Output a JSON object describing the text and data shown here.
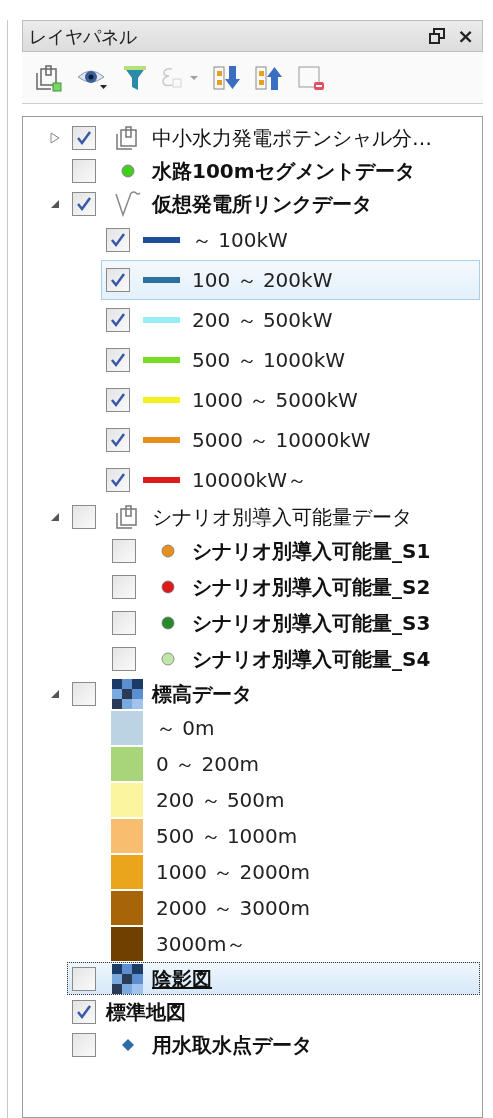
{
  "panel": {
    "title": "レイヤパネル",
    "close": "×"
  },
  "toolbar": [
    {
      "kind": "add-group",
      "disabled": false
    },
    {
      "kind": "visibility",
      "disabled": false
    },
    {
      "kind": "filter",
      "disabled": false
    },
    {
      "kind": "expression",
      "disabled": true
    },
    {
      "kind": "move-down",
      "disabled": false
    },
    {
      "kind": "move-up",
      "disabled": false
    },
    {
      "kind": "remove",
      "disabled": false
    }
  ],
  "tree": [
    {
      "kind": "group",
      "expanded": false,
      "checked": true,
      "bold": false,
      "selected": false,
      "label": "中小水力発電ポテンシャル分…"
    },
    {
      "kind": "point",
      "checked": false,
      "color": "#44cc22",
      "bold": true,
      "selected": false,
      "label": "水路100mセグメントデータ"
    },
    {
      "kind": "line",
      "expanded": true,
      "checked": true,
      "bold": true,
      "selected": false,
      "label": "仮想発電所リンクデータ",
      "children": [
        {
          "kind": "line_class",
          "checked": true,
          "color": "#1f4e99",
          "selected": false,
          "label": "～ 100kW"
        },
        {
          "kind": "line_class",
          "checked": true,
          "color": "#2c6fa0",
          "selected": true,
          "label": "100 ～ 200kW"
        },
        {
          "kind": "line_class",
          "checked": true,
          "color": "#99eef5",
          "selected": false,
          "label": "200 ～ 500kW"
        },
        {
          "kind": "line_class",
          "checked": true,
          "color": "#77dd22",
          "selected": false,
          "label": "500 ～ 1000kW"
        },
        {
          "kind": "line_class",
          "checked": true,
          "color": "#f5f020",
          "selected": false,
          "label": "1000 ～ 5000kW"
        },
        {
          "kind": "line_class",
          "checked": true,
          "color": "#e8901e",
          "selected": false,
          "label": "5000 ～ 10000kW"
        },
        {
          "kind": "line_class",
          "checked": true,
          "color": "#dd1b1b",
          "selected": false,
          "label": "10000kW～"
        }
      ]
    },
    {
      "kind": "group",
      "expanded": true,
      "checked": false,
      "bold": false,
      "selected": false,
      "label": "シナリオ別導入可能量データ",
      "children": [
        {
          "kind": "point",
          "checked": false,
          "color": "#e8901e",
          "bold": true,
          "selected": false,
          "label": "シナリオ別導入可能量_S1"
        },
        {
          "kind": "point",
          "checked": false,
          "color": "#dd1b1b",
          "bold": true,
          "selected": false,
          "label": "シナリオ別導入可能量_S2"
        },
        {
          "kind": "point",
          "checked": false,
          "color": "#2a8a2a",
          "bold": true,
          "selected": false,
          "label": "シナリオ別導入可能量_S3"
        },
        {
          "kind": "point",
          "checked": false,
          "color": "#bde6a8",
          "bold": true,
          "selected": false,
          "label": "シナリオ別導入可能量_S4"
        }
      ]
    },
    {
      "kind": "raster",
      "expanded": true,
      "checked": false,
      "bold": true,
      "selected": false,
      "label": "標高データ",
      "children": [
        {
          "kind": "swatch",
          "color": "#bcd3e3",
          "label": "～ 0m"
        },
        {
          "kind": "swatch",
          "color": "#a8d47a",
          "label": "0 ～ 200m"
        },
        {
          "kind": "swatch",
          "color": "#fbf5a0",
          "label": "200 ～ 500m"
        },
        {
          "kind": "swatch",
          "color": "#f8bd6e",
          "label": "500 ～ 1000m"
        },
        {
          "kind": "swatch",
          "color": "#eaa51c",
          "label": "1000 ～ 2000m"
        },
        {
          "kind": "swatch",
          "color": "#a86408",
          "label": "2000 ～ 3000m"
        },
        {
          "kind": "swatch",
          "color": "#704000",
          "label": "3000m～"
        }
      ]
    },
    {
      "kind": "raster",
      "checked": false,
      "bold": true,
      "selected": true,
      "label": "陰影図"
    },
    {
      "kind": "plain",
      "checked": true,
      "bold": true,
      "selected": false,
      "label": "標準地図"
    },
    {
      "kind": "diamond",
      "checked": false,
      "color": "#2f6aa8",
      "bold": true,
      "selected": false,
      "label": "用水取水点データ"
    }
  ]
}
